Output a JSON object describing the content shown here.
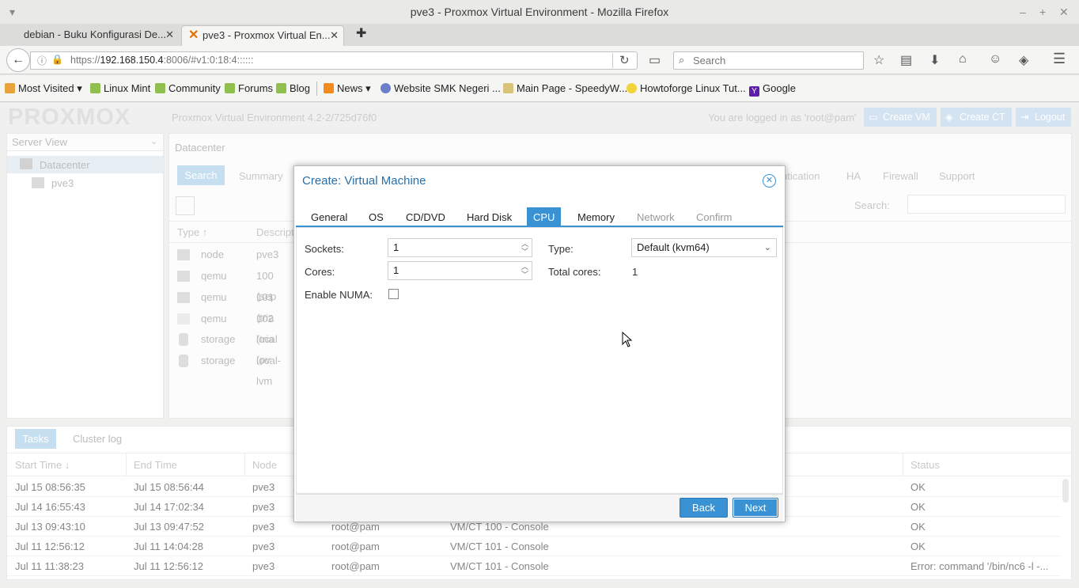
{
  "window": {
    "title": "pve3 - Proxmox Virtual Environment - Mozilla Firefox"
  },
  "tabs": [
    {
      "label": "debian - Buku Konfigurasi De..."
    },
    {
      "label": "pve3 - Proxmox Virtual En..."
    }
  ],
  "nav": {
    "url_prefix": "https://",
    "url_host": "192.168.150.4",
    "url_rest": ":8006/#v1:0:18:4::::::",
    "search_placeholder": "Search"
  },
  "bookmarks": [
    "Most Visited",
    "Linux Mint",
    "Community",
    "Forums",
    "Blog",
    "News",
    "Website SMK Negeri ...",
    "Main Page - SpeedyW...",
    "Howtoforge Linux Tut...",
    "Google"
  ],
  "pve": {
    "logo": "PROXMOX",
    "version": "Proxmox Virtual Environment 4.2-2/725d76f0",
    "logged_in": "You are logged in as 'root@pam'",
    "create_vm": "Create VM",
    "create_ct": "Create CT",
    "logout": "Logout",
    "server_view": "Server View",
    "tree": {
      "root": "Datacenter",
      "node": "pve3"
    },
    "breadcrumb": "Datacenter",
    "main_tabs": [
      "Search",
      "Summary",
      "ntication",
      "HA",
      "Firewall",
      "Support"
    ],
    "search_label": "Search:",
    "grid_headers": {
      "type": "Type",
      "desc": "Descript"
    },
    "grid_rows": [
      {
        "type": "node",
        "desc": "pve3"
      },
      {
        "type": "qemu",
        "desc": "100 (sep"
      },
      {
        "type": "qemu",
        "desc": "101 (tria"
      },
      {
        "type": "qemu",
        "desc": "102 (tria"
      },
      {
        "type": "storage",
        "desc": "local (pv"
      },
      {
        "type": "storage",
        "desc": "local-lvm"
      }
    ]
  },
  "tasks": {
    "tabs": [
      "Tasks",
      "Cluster log"
    ],
    "headers": {
      "start": "Start Time",
      "end": "End Time",
      "node": "Node",
      "status": "Status"
    },
    "rows": [
      {
        "start": "Jul 15 08:56:35",
        "end": "Jul 15 08:56:44",
        "node": "pve3",
        "user": "",
        "desc": "",
        "status": "OK"
      },
      {
        "start": "Jul 14 16:55:43",
        "end": "Jul 14 17:02:34",
        "node": "pve3",
        "user": "",
        "desc": "",
        "status": "OK"
      },
      {
        "start": "Jul 13 09:43:10",
        "end": "Jul 13 09:47:52",
        "node": "pve3",
        "user": "root@pam",
        "desc": "VM/CT 100 - Console",
        "status": "OK"
      },
      {
        "start": "Jul 11 12:56:12",
        "end": "Jul 11 14:04:28",
        "node": "pve3",
        "user": "root@pam",
        "desc": "VM/CT 101 - Console",
        "status": "OK"
      },
      {
        "start": "Jul 11 11:38:23",
        "end": "Jul 11 12:56:12",
        "node": "pve3",
        "user": "root@pam",
        "desc": "VM/CT 101 - Console",
        "status": "Error: command '/bin/nc6 -l -..."
      }
    ]
  },
  "dialog": {
    "title": "Create: Virtual Machine",
    "tabs": [
      "General",
      "OS",
      "CD/DVD",
      "Hard Disk",
      "CPU",
      "Memory",
      "Network",
      "Confirm"
    ],
    "sockets_label": "Sockets:",
    "sockets_value": "1",
    "cores_label": "Cores:",
    "cores_value": "1",
    "numa_label": "Enable NUMA:",
    "type_label": "Type:",
    "type_value": "Default (kvm64)",
    "total_cores_label": "Total cores:",
    "total_cores_value": "1",
    "back": "Back",
    "next": "Next"
  },
  "colors": {
    "accent": "#3892d4",
    "header_btn": "#bcd4ea"
  }
}
